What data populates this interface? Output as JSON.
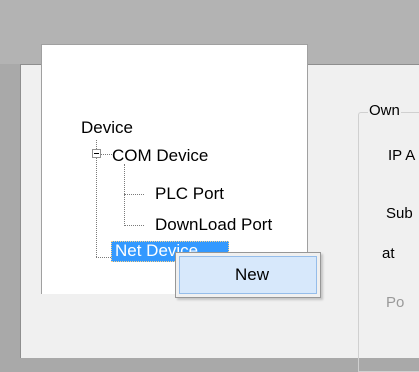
{
  "tree": {
    "root": "Device",
    "com_device": "COM Device",
    "plc_port": "PLC Port",
    "download_port": "DownLoad Port",
    "net_device": "Net Device"
  },
  "context_menu": {
    "new_label": "New"
  },
  "right_panel": {
    "group_title": "Own",
    "ip_label": "IP A",
    "subnet_label": "Sub",
    "gateway_label": "at",
    "port_label": "Po"
  }
}
